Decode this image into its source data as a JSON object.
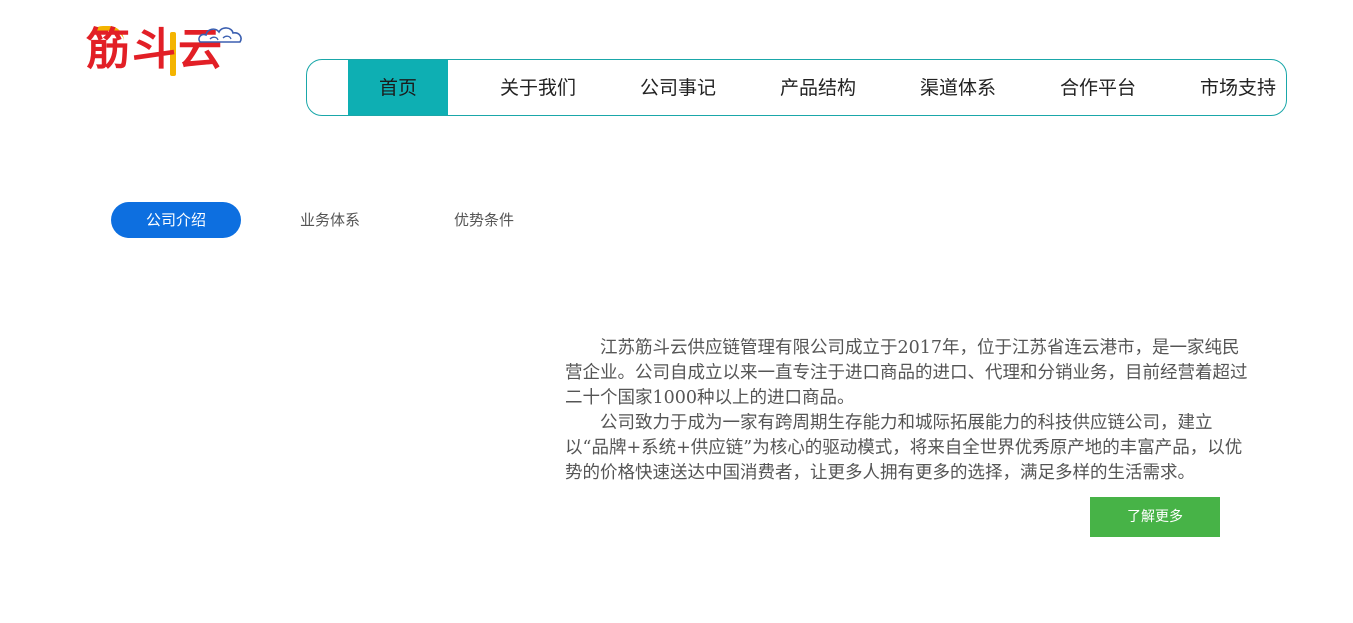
{
  "logo": {
    "text": "筋斗云"
  },
  "nav": {
    "items": [
      {
        "label": "首页"
      },
      {
        "label": "关于我们"
      },
      {
        "label": "公司事记"
      },
      {
        "label": "产品结构"
      },
      {
        "label": "渠道体系"
      },
      {
        "label": "合作平台"
      },
      {
        "label": "市场支持"
      }
    ],
    "active_index": 0
  },
  "subtabs": {
    "items": [
      {
        "label": "公司介绍"
      },
      {
        "label": "业务体系"
      },
      {
        "label": "优势条件"
      }
    ],
    "active_index": 0
  },
  "intro": {
    "paragraphs": [
      "江苏筋斗云供应链管理有限公司成立于2017年，位于江苏省连云港市，是一家纯民营企业。公司自成立以来一直专注于进口商品的进口、代理和分销业务，目前经营着超过二十个国家1000种以上的进口商品。",
      "公司致力于成为一家有跨周期生存能力和城际拓展能力的科技供应链公司，建立以“品牌+系统+供应链”为核心的驱动模式，将来自全世界优秀原产地的丰富产品，以优势的价格快速送达中国消费者，让更多人拥有更多的选择，满足多样的生活需求。"
    ],
    "more_label": "了解更多"
  },
  "colors": {
    "nav_border": "#1aa7a9",
    "nav_active": "#0eafb3",
    "subtab_active": "#0d6fe0",
    "more_button": "#47b347",
    "logo_red": "#e21f26",
    "logo_yellow": "#f4b400"
  }
}
